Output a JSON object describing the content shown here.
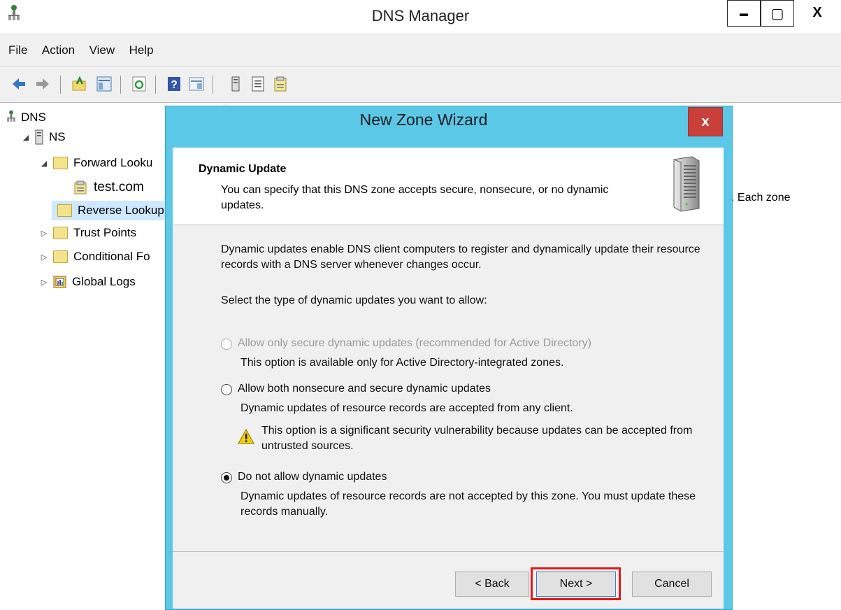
{
  "window": {
    "title": "DNS Manager",
    "controls": {
      "minimize": "▬",
      "maximize": "▢",
      "close": "X"
    }
  },
  "menu": [
    "File",
    "Action",
    "View",
    "Help"
  ],
  "toolbar": {
    "icons": [
      "back-arrow-icon",
      "forward-arrow-icon",
      "up-folder-icon",
      "show-hide-tree-icon",
      "refresh-icon",
      "help-icon",
      "show-action-pane-icon",
      "server-icon",
      "list-icon",
      "properties-icon"
    ]
  },
  "tree": {
    "root": "DNS",
    "server": "NS",
    "forward": "Forward Looku",
    "zone": "test.com",
    "reverse": "Reverse Lookup",
    "trust": "Trust Points",
    "conditional": "Conditional Fo",
    "logs": "Global Logs"
  },
  "right_pane": {
    "fragment": ". Each zone"
  },
  "dialog": {
    "title": "New Zone Wizard",
    "close": "x",
    "header_title": "Dynamic Update",
    "header_sub": "You can specify that this DNS zone accepts secure, nonsecure, or no dynamic updates.",
    "intro": "Dynamic updates enable DNS client computers to register and dynamically update their resource records with a DNS server whenever changes occur.",
    "prompt": "Select the type of dynamic updates you want to allow:",
    "options": [
      {
        "label": "Allow only secure dynamic updates (recommended for Active Directory)",
        "desc": "This option is available only for Active Directory-integrated zones.",
        "enabled": false,
        "selected": false
      },
      {
        "label": "Allow both nonsecure and secure dynamic updates",
        "desc": "Dynamic updates of resource records are accepted from any client.",
        "warning": "This option is a significant security vulnerability because updates can be accepted from untrusted sources.",
        "enabled": true,
        "selected": false
      },
      {
        "label": "Do not allow dynamic updates",
        "desc": "Dynamic updates of resource records are not accepted by this zone. You must update these records manually.",
        "enabled": true,
        "selected": true
      }
    ],
    "buttons": {
      "back": "< Back",
      "next": "Next >",
      "cancel": "Cancel"
    }
  },
  "colors": {
    "dialog_frame": "#5bc8e8",
    "close_red": "#c9403a",
    "highlight": "#e31818"
  }
}
